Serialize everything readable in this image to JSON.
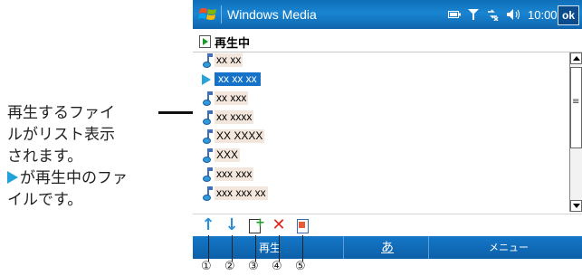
{
  "callout": {
    "line1": "再生するファイ",
    "line2": "ルがリスト表示",
    "line3": "されます。",
    "line4": "が再生中のファ",
    "line5": "イルです。"
  },
  "titlebar": {
    "title": "Windows Media",
    "time": "10:00",
    "ok_label": "ok",
    "icons": [
      "windows-start-icon",
      "battery-icon",
      "signal-icon",
      "connectivity-icon",
      "volume-icon"
    ]
  },
  "playlist": {
    "title": "再生中",
    "items": [
      {
        "label": "xx xx",
        "state": "normal"
      },
      {
        "label": "xx xx xx",
        "state": "playing-selected"
      },
      {
        "label": "xx xxx",
        "state": "normal"
      },
      {
        "label": "xx xxxx",
        "state": "normal"
      },
      {
        "label": "XX XXXX",
        "state": "normal"
      },
      {
        "label": "XXX",
        "state": "normal"
      },
      {
        "label": "xxx xxx",
        "state": "normal"
      },
      {
        "label": "xxx xxx xx",
        "state": "normal"
      }
    ]
  },
  "toolbar": {
    "buttons": [
      "move-up-icon",
      "move-down-icon",
      "add-file-icon",
      "delete-icon",
      "properties-icon"
    ]
  },
  "menubar": {
    "left": "再生",
    "ime": "あ",
    "right": "メニュー"
  },
  "callout_numbers": [
    "①",
    "②",
    "③",
    "④",
    "⑤"
  ]
}
